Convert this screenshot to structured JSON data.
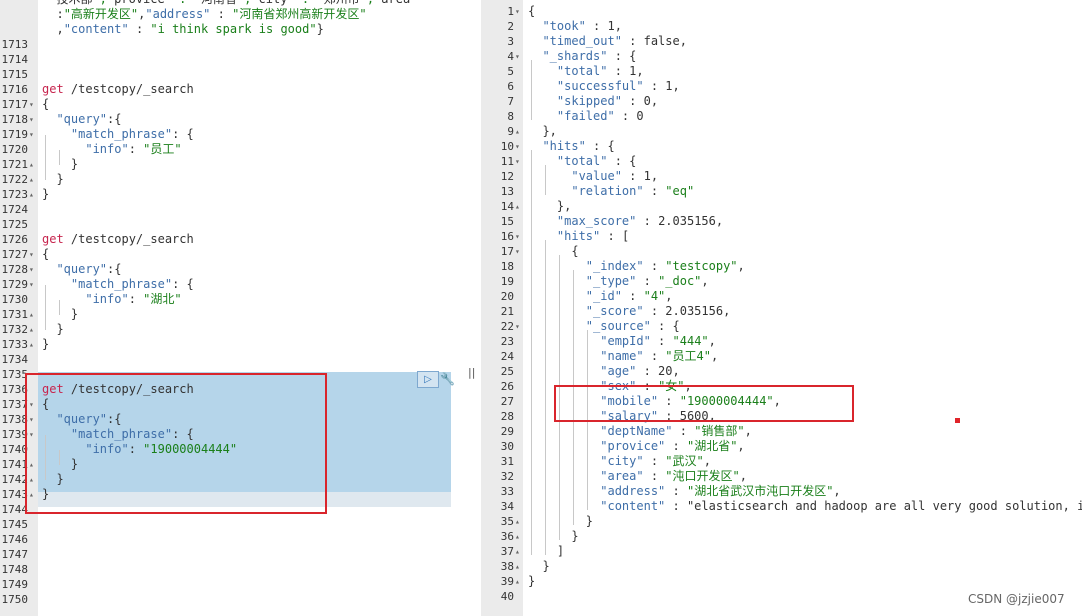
{
  "left_editor": {
    "lines": [
      {
        "n": "",
        "fold": "",
        "text": "  技术部\",\"provice\" : \"河南省\",\"city\" : \"郑州市\",\"area\""
      },
      {
        "n": "",
        "fold": "",
        "text": "  :\"高新开发区\",\"address\" : \"河南省郑州高新开发区\""
      },
      {
        "n": "",
        "fold": "",
        "text": "  ,\"content\" : \"i think spark is good\"}"
      },
      {
        "n": "1713",
        "fold": "",
        "text": ""
      },
      {
        "n": "1714",
        "fold": "",
        "text": ""
      },
      {
        "n": "1715",
        "fold": "",
        "text": ""
      },
      {
        "n": "1716",
        "fold": "",
        "text": "get /testcopy/_search"
      },
      {
        "n": "1717",
        "fold": "▾",
        "text": "{"
      },
      {
        "n": "1718",
        "fold": "▾",
        "text": "  \"query\":{"
      },
      {
        "n": "1719",
        "fold": "▾",
        "text": "    \"match_phrase\": {"
      },
      {
        "n": "1720",
        "fold": "",
        "text": "      \"info\": \"员工\""
      },
      {
        "n": "1721",
        "fold": "▴",
        "text": "    }"
      },
      {
        "n": "1722",
        "fold": "▴",
        "text": "  }"
      },
      {
        "n": "1723",
        "fold": "▴",
        "text": "}"
      },
      {
        "n": "1724",
        "fold": "",
        "text": ""
      },
      {
        "n": "1725",
        "fold": "",
        "text": ""
      },
      {
        "n": "1726",
        "fold": "",
        "text": "get /testcopy/_search"
      },
      {
        "n": "1727",
        "fold": "▾",
        "text": "{"
      },
      {
        "n": "1728",
        "fold": "▾",
        "text": "  \"query\":{"
      },
      {
        "n": "1729",
        "fold": "▾",
        "text": "    \"match_phrase\": {"
      },
      {
        "n": "1730",
        "fold": "",
        "text": "      \"info\": \"湖北\""
      },
      {
        "n": "1731",
        "fold": "▴",
        "text": "    }"
      },
      {
        "n": "1732",
        "fold": "▴",
        "text": "  }"
      },
      {
        "n": "1733",
        "fold": "▴",
        "text": "}"
      },
      {
        "n": "1734",
        "fold": "",
        "text": ""
      },
      {
        "n": "1735",
        "fold": "",
        "text": ""
      },
      {
        "n": "1736",
        "fold": "",
        "text": "get /testcopy/_search"
      },
      {
        "n": "1737",
        "fold": "▾",
        "text": "{"
      },
      {
        "n": "1738",
        "fold": "▾",
        "text": "  \"query\":{"
      },
      {
        "n": "1739",
        "fold": "▾",
        "text": "    \"match_phrase\": {"
      },
      {
        "n": "1740",
        "fold": "",
        "text": "      \"info\": \"19000004444\""
      },
      {
        "n": "1741",
        "fold": "▴",
        "text": "    }"
      },
      {
        "n": "1742",
        "fold": "▴",
        "text": "  }"
      },
      {
        "n": "1743",
        "fold": "▴",
        "text": "}"
      },
      {
        "n": "1744",
        "fold": "",
        "text": ""
      },
      {
        "n": "1745",
        "fold": "",
        "text": ""
      },
      {
        "n": "1746",
        "fold": "",
        "text": ""
      },
      {
        "n": "1747",
        "fold": "",
        "text": ""
      },
      {
        "n": "1748",
        "fold": "",
        "text": ""
      },
      {
        "n": "1749",
        "fold": "",
        "text": ""
      },
      {
        "n": "1750",
        "fold": "",
        "text": ""
      }
    ]
  },
  "right_editor": {
    "lines": [
      {
        "n": "1",
        "fold": "▾",
        "text": "{"
      },
      {
        "n": "2",
        "fold": "",
        "text": "  \"took\" : 1,"
      },
      {
        "n": "3",
        "fold": "",
        "text": "  \"timed_out\" : false,"
      },
      {
        "n": "4",
        "fold": "▾",
        "text": "  \"_shards\" : {"
      },
      {
        "n": "5",
        "fold": "",
        "text": "    \"total\" : 1,"
      },
      {
        "n": "6",
        "fold": "",
        "text": "    \"successful\" : 1,"
      },
      {
        "n": "7",
        "fold": "",
        "text": "    \"skipped\" : 0,"
      },
      {
        "n": "8",
        "fold": "",
        "text": "    \"failed\" : 0"
      },
      {
        "n": "9",
        "fold": "▴",
        "text": "  },"
      },
      {
        "n": "10",
        "fold": "▾",
        "text": "  \"hits\" : {"
      },
      {
        "n": "11",
        "fold": "▾",
        "text": "    \"total\" : {"
      },
      {
        "n": "12",
        "fold": "",
        "text": "      \"value\" : 1,"
      },
      {
        "n": "13",
        "fold": "",
        "text": "      \"relation\" : \"eq\""
      },
      {
        "n": "14",
        "fold": "▴",
        "text": "    },"
      },
      {
        "n": "15",
        "fold": "",
        "text": "    \"max_score\" : 2.035156,"
      },
      {
        "n": "16",
        "fold": "▾",
        "text": "    \"hits\" : ["
      },
      {
        "n": "17",
        "fold": "▾",
        "text": "      {"
      },
      {
        "n": "18",
        "fold": "",
        "text": "        \"_index\" : \"testcopy\","
      },
      {
        "n": "19",
        "fold": "",
        "text": "        \"_type\" : \"_doc\","
      },
      {
        "n": "20",
        "fold": "",
        "text": "        \"_id\" : \"4\","
      },
      {
        "n": "21",
        "fold": "",
        "text": "        \"_score\" : 2.035156,"
      },
      {
        "n": "22",
        "fold": "▾",
        "text": "        \"_source\" : {"
      },
      {
        "n": "23",
        "fold": "",
        "text": "          \"empId\" : \"444\","
      },
      {
        "n": "24",
        "fold": "",
        "text": "          \"name\" : \"员工4\","
      },
      {
        "n": "25",
        "fold": "",
        "text": "          \"age\" : 20,"
      },
      {
        "n": "26",
        "fold": "",
        "text": "          \"sex\" : \"女\","
      },
      {
        "n": "27",
        "fold": "",
        "text": "          \"mobile\" : \"19000004444\","
      },
      {
        "n": "28",
        "fold": "",
        "text": "          \"salary\" : 5600,"
      },
      {
        "n": "29",
        "fold": "",
        "text": "          \"deptName\" : \"销售部\","
      },
      {
        "n": "30",
        "fold": "",
        "text": "          \"provice\" : \"湖北省\","
      },
      {
        "n": "31",
        "fold": "",
        "text": "          \"city\" : \"武汉\","
      },
      {
        "n": "32",
        "fold": "",
        "text": "          \"area\" : \"沌口开发区\","
      },
      {
        "n": "33",
        "fold": "",
        "text": "          \"address\" : \"湖北省武汉市沌口开发区\","
      },
      {
        "n": "34",
        "fold": "",
        "text": "          \"content\" : \"elasticsearch and hadoop are all very good solution, i am"
      },
      {
        "n": "35",
        "fold": "▴",
        "text": "        }"
      },
      {
        "n": "36",
        "fold": "▴",
        "text": "      }"
      },
      {
        "n": "37",
        "fold": "▴",
        "text": "    ]"
      },
      {
        "n": "38",
        "fold": "▴",
        "text": "  }"
      },
      {
        "n": "39",
        "fold": "▴",
        "text": "}"
      },
      {
        "n": "40",
        "fold": "",
        "text": ""
      }
    ]
  },
  "icons": {
    "run": "play-icon",
    "settings": "wrench-icon",
    "splitter": "pane-splitter-icon"
  },
  "colors": {
    "highlight": "#b5d5ea",
    "annotation_red": "#d9252c",
    "keyword": "#c7254e",
    "key": "#3e6ea8",
    "string": "#1a7f1a"
  },
  "watermark": "CSDN @jzjie007"
}
